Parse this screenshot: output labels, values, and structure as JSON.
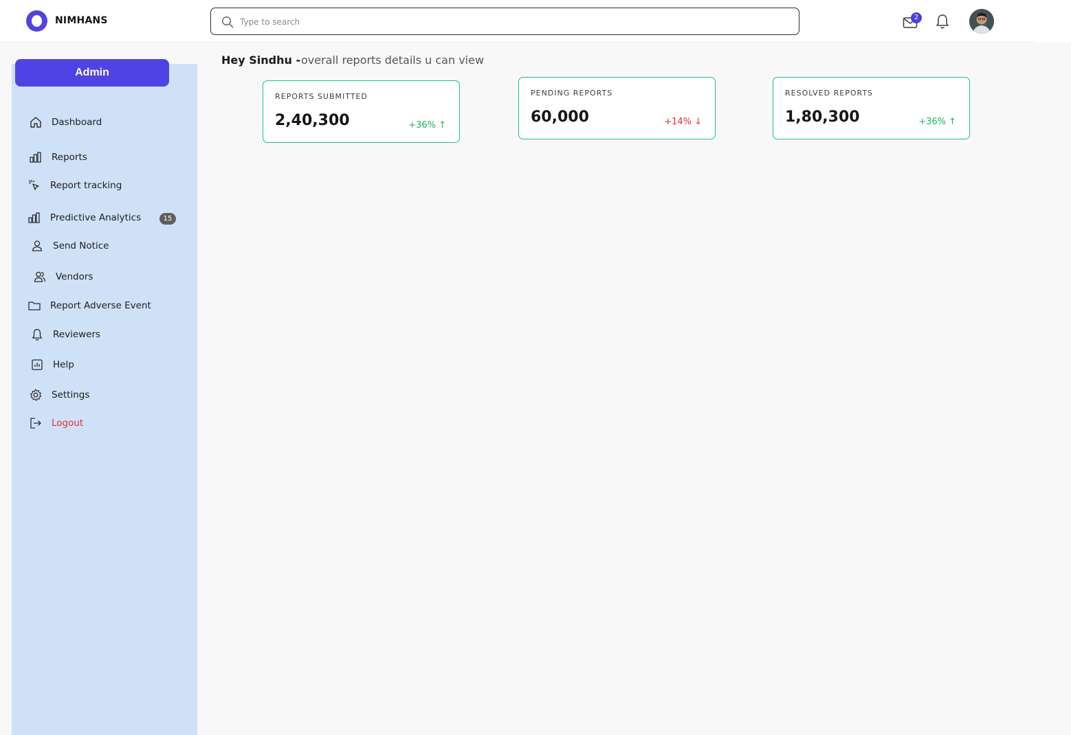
{
  "header": {
    "brand": "NIMHANS",
    "search": {
      "placeholder": "Type to search",
      "value": ""
    },
    "mail_badge": "2"
  },
  "sidebar": {
    "role_button": "Admin",
    "items": [
      {
        "label": "Dashboard",
        "icon": "home-icon"
      },
      {
        "label": "Reports",
        "icon": "bar-chart-icon"
      },
      {
        "label": "Report tracking",
        "icon": "cursor-click-icon"
      },
      {
        "label": "Predictive Analytics",
        "icon": "bar-chart-icon",
        "badge": "15"
      },
      {
        "label": "Send Notice",
        "icon": "user-icon"
      },
      {
        "label": "Vendors",
        "icon": "users-icon"
      },
      {
        "label": "Report Adverse Event",
        "icon": "folder-icon"
      },
      {
        "label": "Reviewers",
        "icon": "bell-icon"
      },
      {
        "label": "Help",
        "icon": "chart-box-icon"
      },
      {
        "label": "Settings",
        "icon": "gear-icon"
      },
      {
        "label": "Logout",
        "icon": "logout-icon"
      }
    ]
  },
  "greeting": {
    "name": "Hey Sindhu  -",
    "subtitle": "overall reports details u can view"
  },
  "stats": [
    {
      "title": "REPORTS SUBMITTED",
      "value": "2,40,300",
      "change": "+36% ↑",
      "trend": "up"
    },
    {
      "title": "PENDING REPORTS",
      "value": "60,000",
      "change": "+14% ↓",
      "trend": "down"
    },
    {
      "title": "RESOLVED REPORTS",
      "value": "1,80,300",
      "change": "+36% ↑",
      "trend": "up"
    }
  ],
  "colors": {
    "accent": "#4f44e3",
    "sidebar_bg": "#cfe1f7",
    "card_border": "#1ec27e",
    "positive": "#22b45c",
    "negative": "#e03131"
  }
}
